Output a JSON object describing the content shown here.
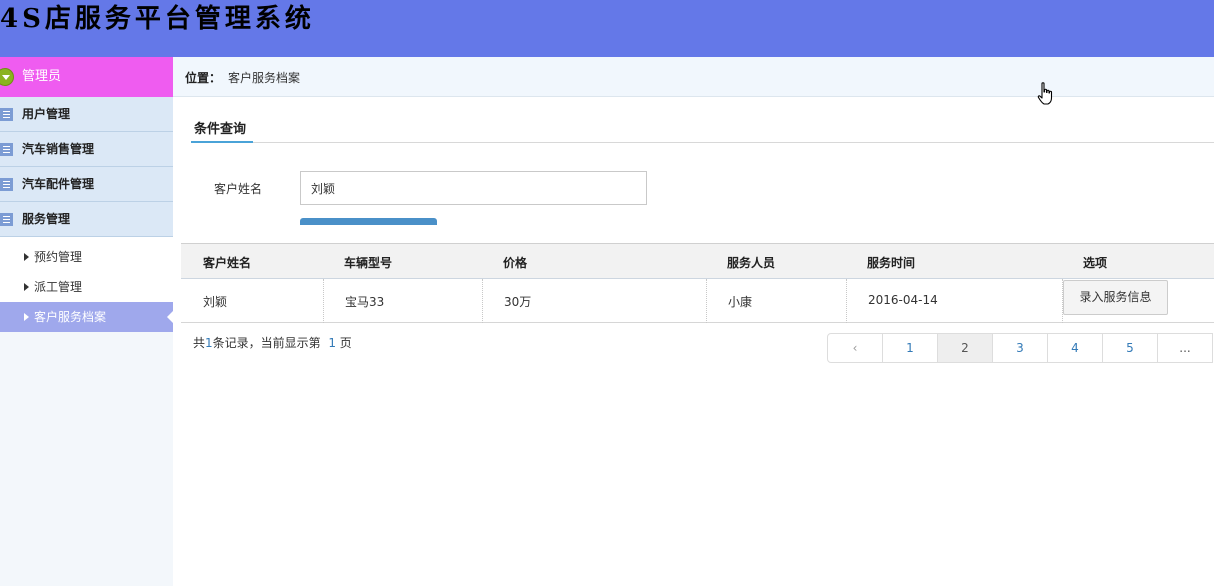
{
  "header": {
    "title": "4S店服务平台管理系统"
  },
  "sidebar": {
    "admin_label": "管理员",
    "menu": [
      {
        "label": "用户管理"
      },
      {
        "label": "汽车销售管理"
      },
      {
        "label": "汽车配件管理"
      },
      {
        "label": "服务管理"
      }
    ],
    "submenu": [
      {
        "label": "预约管理"
      },
      {
        "label": "派工管理"
      },
      {
        "label": "客户服务档案",
        "active": true
      }
    ]
  },
  "breadcrumb": {
    "label": "位置：",
    "value": "客户服务档案"
  },
  "query": {
    "tab_label": "条件查询",
    "field_label": "客户姓名",
    "field_value": "刘颖"
  },
  "table": {
    "headers": [
      "客户姓名",
      "车辆型号",
      "价格",
      "服务人员",
      "服务时间",
      "选项"
    ],
    "rows": [
      {
        "name": "刘颖",
        "model": "宝马33",
        "price": "30万",
        "staff": "小康",
        "time": "2016-04-14",
        "action": "录入服务信息"
      }
    ]
  },
  "summary": {
    "prefix": "共",
    "total": "1",
    "mid": "条记录，当前显示第",
    "page": "1",
    "suffix": "页"
  },
  "pagination": {
    "prev": "‹",
    "pages": [
      "1",
      "2",
      "3",
      "4",
      "5"
    ],
    "current": "2",
    "ellipsis": "..."
  },
  "colors": {
    "header_bg": "#6478e8",
    "admin_bar": "#ef5cf0",
    "active_sub": "#9fa8ec",
    "link": "#337ab7"
  }
}
